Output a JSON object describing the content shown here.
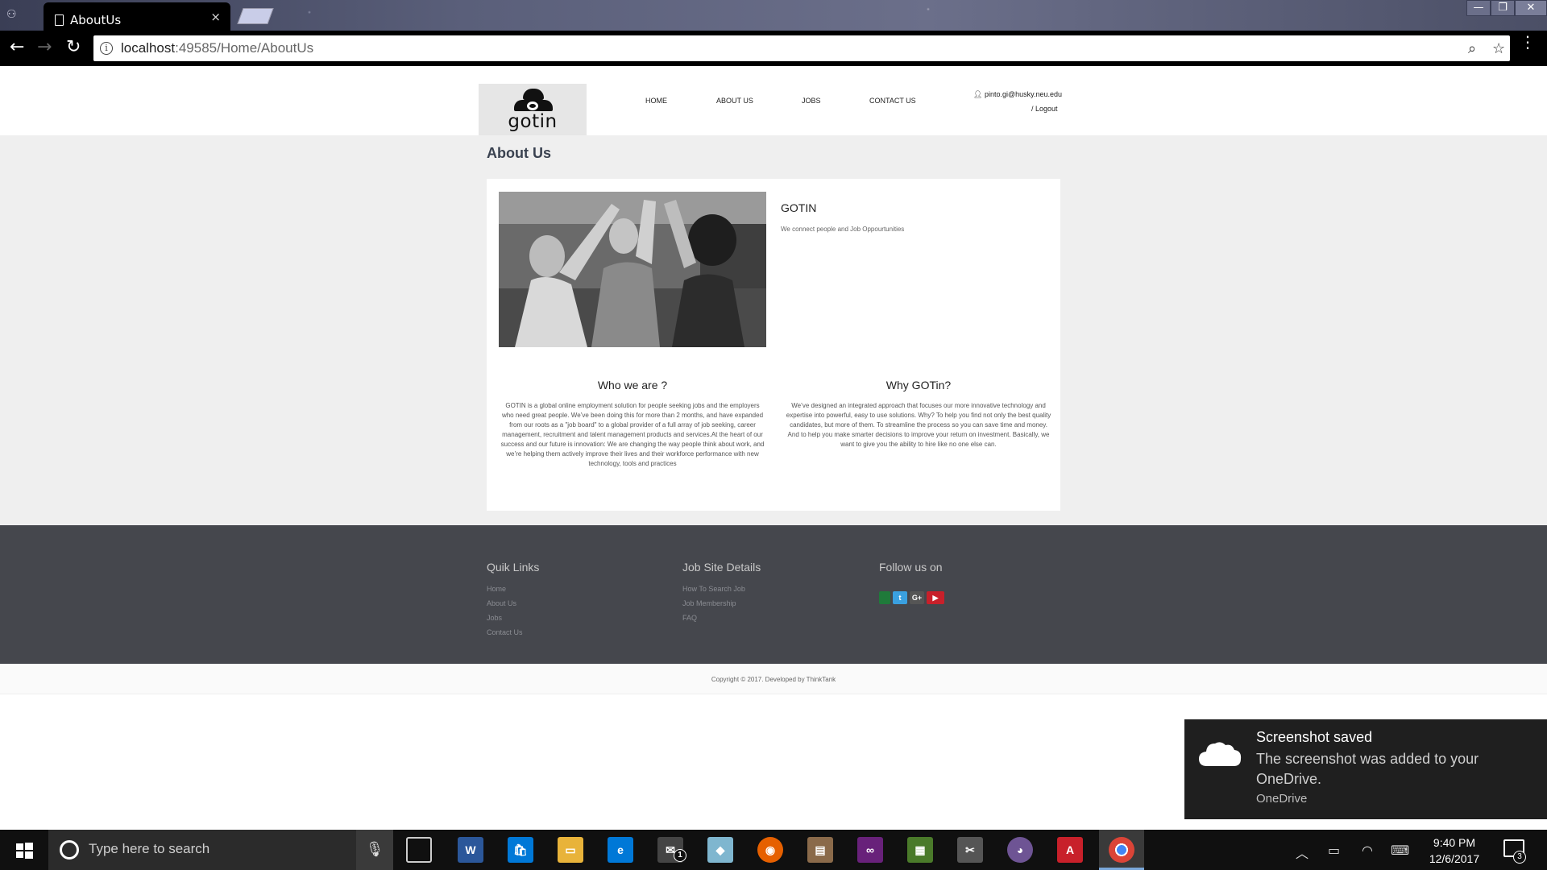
{
  "browser": {
    "tab_title": "AboutUs",
    "tab_close": "×",
    "url_host": "localhost",
    "url_rest": ":49585/Home/AboutUs",
    "window_buttons": [
      "—",
      "❐",
      "✕"
    ]
  },
  "site": {
    "logo_text": "gotin",
    "nav": [
      "HOME",
      "ABOUT US",
      "JOBS",
      "CONTACT US"
    ],
    "user_email": "pinto.gi@husky.neu.edu",
    "logout": "/ Logout",
    "page_title": "About Us",
    "gotin_title": "GOTIN",
    "gotin_sub": "We connect people and Job Oppourtunities",
    "who_title": "Who we are ?",
    "who_text": "GOTIN is a global online employment solution for people seeking jobs and the employers who need great people. We’ve been doing this for more than 2 months, and have expanded from our roots as a \"job board\" to a global provider of a full array of job seeking, career management, recruitment and talent management products and services.At the heart of our success and our future is innovation: We are changing the way people think about work, and we’re helping them actively improve their lives and their workforce performance with new technology, tools and practices",
    "why_title": "Why GOTin?",
    "why_text": "We’ve designed an integrated approach that focuses our more innovative technology and expertise into powerful, easy to use solutions. Why? To help you find not only the best quality candidates, but more of them. To streamline the process so you can save time and money. And to help you make smarter decisions to improve your return on investment. Basically, we want to give you the ability to hire like no one else can."
  },
  "footer": {
    "quick_title": "Quik Links",
    "quick_links": [
      "Home",
      "About Us",
      "Jobs",
      "Contact Us"
    ],
    "details_title": "Job Site Details",
    "details_links": [
      "How To Search Job",
      "Job Membership",
      "FAQ"
    ],
    "follow_title": "Follow us on",
    "social": [
      {
        "label": "",
        "color": "#1f7a3a",
        "icon": "facebook-icon"
      },
      {
        "label": "t",
        "color": "#3aa0e0",
        "icon": "twitter-icon"
      },
      {
        "label": "G+",
        "color": "#555555",
        "icon": "google-plus-icon"
      },
      {
        "label": "▶",
        "color": "#c8202a",
        "icon": "youtube-icon"
      }
    ],
    "copyright": "Copyright © 2017. Developed by ThinkTank"
  },
  "toast": {
    "title": "Screenshot saved",
    "body": "The screenshot was added to your OneDrive.",
    "app": "OneDrive"
  },
  "taskbar": {
    "search_placeholder": "Type here to search",
    "time": "9:40 PM",
    "date": "12/6/2017",
    "notification_count": "3",
    "mail_badge": "1"
  }
}
